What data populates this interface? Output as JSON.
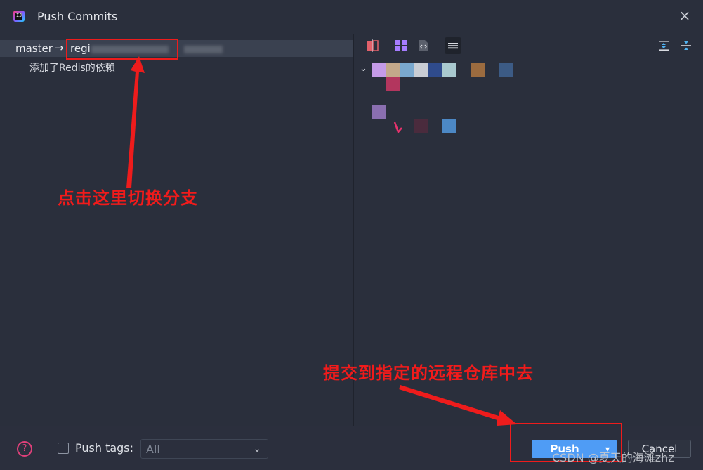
{
  "window": {
    "title": "Push Commits",
    "close_glyph": "×"
  },
  "left": {
    "branch_from": "master",
    "arrow": "→",
    "branch_to": "regi",
    "commit_message": "添加了Redis的依赖"
  },
  "annotations": {
    "top": "点击这里切换分支",
    "bottom": "提交到指定的远程仓库中去"
  },
  "toolbar": {
    "icons": [
      "diff-icon",
      "grid-icon",
      "code-file-icon",
      "list-icon",
      "expand-all-icon",
      "collapse-all-icon"
    ]
  },
  "bottom": {
    "help_glyph": "?",
    "push_tags_label": "Push tags:",
    "push_tags_value": "All",
    "push_label": "Push",
    "cancel_label": "Cancel",
    "dropdown_glyph": "▾"
  },
  "watermark": "CSDN @夏天的海滩zhz",
  "colors": {
    "accent_red": "#ee1c1c",
    "push_blue": "#4f9cf5",
    "background": "#2a2f3c"
  }
}
